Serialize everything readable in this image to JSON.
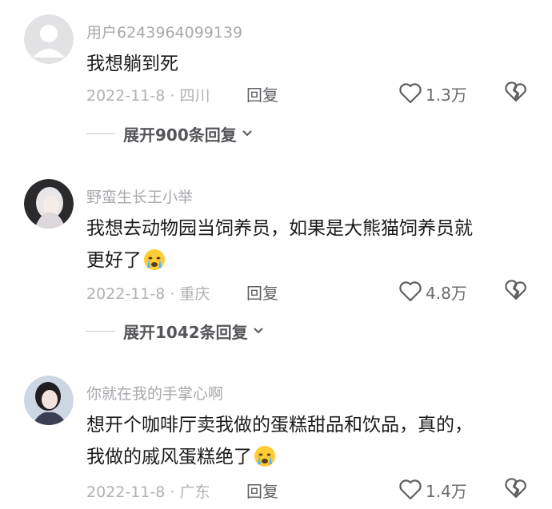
{
  "comments": [
    {
      "username": "用户6243964099139",
      "text_lines": [
        "我想躺到死"
      ],
      "has_emoji": false,
      "date_location": "2022-11-8 · 四川",
      "reply_label": "回复",
      "likes": "1.3万",
      "expand_label": "展开900条回复"
    },
    {
      "username": "野蛮生长王小举",
      "text_lines": [
        "我想去动物园当饲养员，如果是大熊猫饲养员就",
        "更好了"
      ],
      "has_emoji": true,
      "date_location": "2022-11-8 · 重庆",
      "reply_label": "回复",
      "likes": "4.8万",
      "expand_label": "展开1042条回复"
    },
    {
      "username": "你就在我的手掌心啊",
      "text_lines": [
        "想开个咖啡厅卖我做的蛋糕甜品和饮品，真的，",
        "我做的戚风蛋糕绝了"
      ],
      "has_emoji": true,
      "date_location": "2022-11-8 · 广东",
      "reply_label": "回复",
      "likes": "1.4万"
    }
  ],
  "icons": {
    "like": "heart-outline-icon",
    "dislike": "broken-heart-icon",
    "expand": "chevron-down-icon",
    "emoji": "crying-face-emoji"
  },
  "colors": {
    "username": "#a8a8ad",
    "body_text": "#1b1b1b",
    "meta": "#b0b0b5"
  }
}
